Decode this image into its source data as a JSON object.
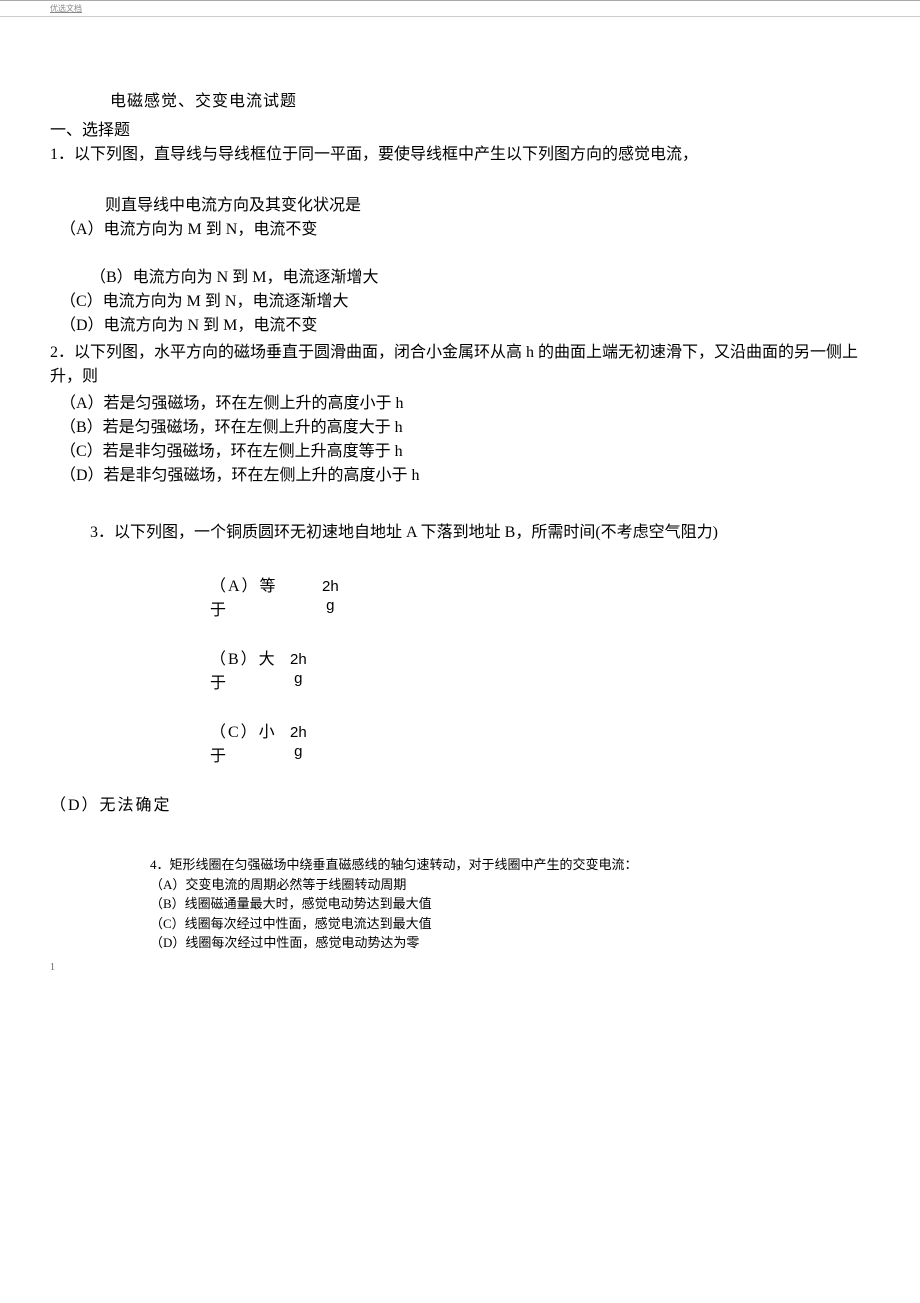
{
  "header": {
    "doc_label": "优选文档"
  },
  "title": "电磁感觉、交变电流试题",
  "section1": "一、选择题",
  "q1": {
    "text": "1．以下列图，直导线与导线框位于同一平面，要使导线框中产生以下列图方向的感觉电流，",
    "sub": "则直导线中电流方向及其变化状况是",
    "a": "（A）电流方向为 M 到 N，电流不变",
    "b": "（B）电流方向为 N 到 M，电流逐渐增大",
    "c": "（C）电流方向为 M 到 N，电流逐渐增大",
    "d": "（D）电流方向为 N 到 M，电流不变"
  },
  "q2": {
    "text": "2．以下列图，水平方向的磁场垂直于圆滑曲面，闭合小金属环从高 h 的曲面上端无初速滑下，又沿曲面的另一侧上升，则",
    "a": "（A）若是匀强磁场，环在左侧上升的高度小于 h",
    "b": "（B）若是匀强磁场，环在左侧上升的高度大于 h",
    "c": "（C）若是非匀强磁场，环在左侧上升高度等于 h",
    "d": "（D）若是非匀强磁场，环在左侧上升的高度小于 h"
  },
  "q3": {
    "text": "3．以下列图，一个铜质圆环无初速地自地址 A 下落到地址 B，所需时间(不考虑空气阻力)",
    "a_label": "（A）等于",
    "b_label": "（B）大于",
    "c_label": "（C）小于",
    "d_label": "（D）无法确定",
    "frac_num": "2h",
    "frac_den": "g"
  },
  "q4": {
    "text": "4．矩形线圈在匀强磁场中绕垂直磁感线的轴匀速转动，对于线圈中产生的交变电流：",
    "a": "（A）交变电流的周期必然等于线圈转动周期",
    "b": "（B）线圈磁通量最大时，感觉电动势达到最大值",
    "c": "（C）线圈每次经过中性面，感觉电流达到最大值",
    "d": "（D）线圈每次经过中性面，感觉电动势达为零"
  },
  "footer": {
    "page": "1"
  }
}
